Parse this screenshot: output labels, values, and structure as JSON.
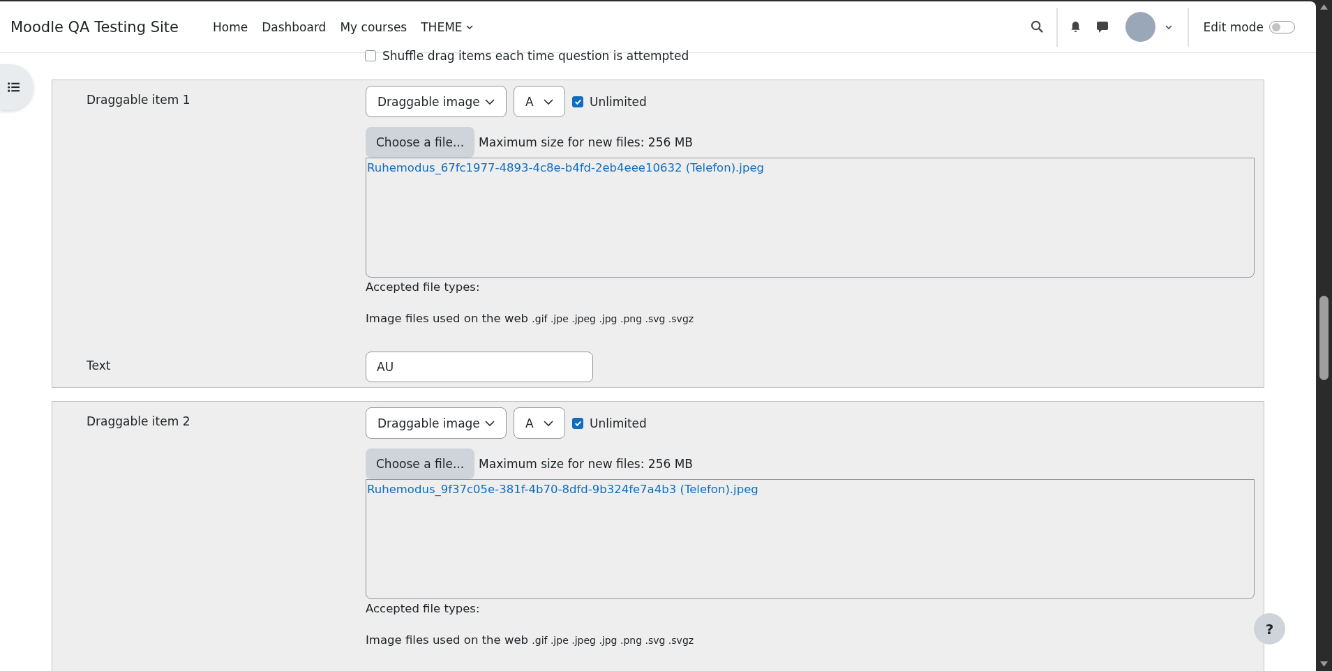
{
  "header": {
    "site_name": "Moodle QA Testing Site",
    "nav": [
      {
        "label": "Home",
        "dropdown": false
      },
      {
        "label": "Dashboard",
        "dropdown": false
      },
      {
        "label": "My courses",
        "dropdown": false
      },
      {
        "label": "THEME",
        "dropdown": true
      }
    ],
    "edit_mode": {
      "label": "Edit mode",
      "on": false
    }
  },
  "shuffle": {
    "label": "Shuffle drag items each time question is attempted",
    "checked": false
  },
  "items": [
    {
      "label": "Draggable item 1",
      "type": "Draggable image",
      "group": "A",
      "unlimited": {
        "label": "Unlimited",
        "checked": true
      },
      "choose_button": "Choose a file...",
      "max_size": "Maximum size for new files: 256 MB",
      "file": "Ruhemodus_67fc1977-4893-4c8e-b4fd-2eb4eee10632 (Telefon).jpeg",
      "accepted_label": "Accepted file types:",
      "accepted_description": "Image files used on the web",
      "extensions": ".gif .jpe .jpeg .jpg .png .svg .svgz",
      "text_label": "Text",
      "text_value": "AU"
    },
    {
      "label": "Draggable item 2",
      "type": "Draggable image",
      "group": "A",
      "unlimited": {
        "label": "Unlimited",
        "checked": true
      },
      "choose_button": "Choose a file...",
      "max_size": "Maximum size for new files: 256 MB",
      "file": "Ruhemodus_9f37c05e-381f-4b70-8dfd-9b324fe7a4b3 (Telefon).jpeg",
      "accepted_label": "Accepted file types:",
      "accepted_description": "Image files used on the web",
      "extensions": ".gif .jpe .jpeg .jpg .png .svg .svgz"
    }
  ],
  "help_button": "?"
}
